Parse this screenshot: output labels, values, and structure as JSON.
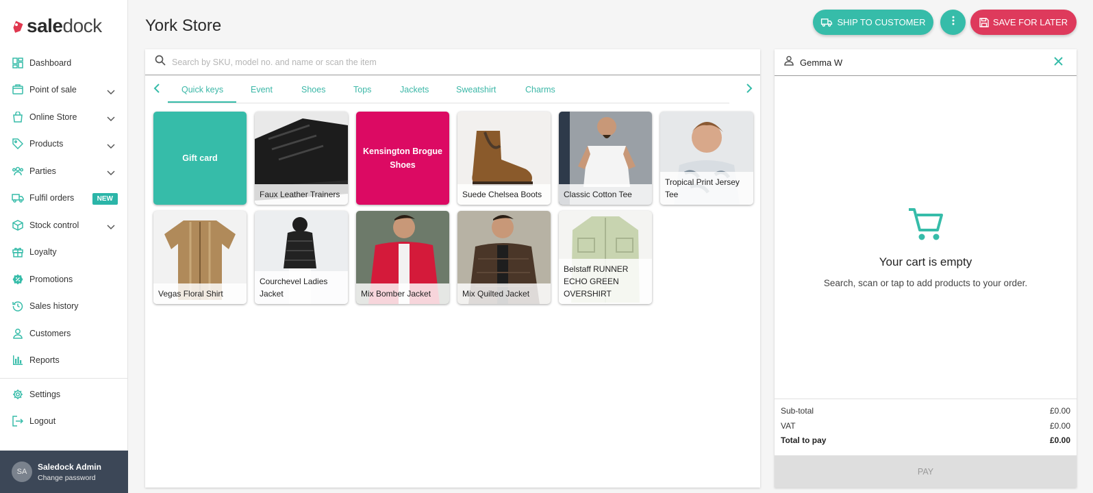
{
  "brand": {
    "logo_text_bold": "sale",
    "logo_text_rest": "dock"
  },
  "sidebar": {
    "items": [
      {
        "label": "Dashboard",
        "icon": "dashboard-icon",
        "has_chevron": false
      },
      {
        "label": "Point of sale",
        "icon": "register-icon",
        "has_chevron": true
      },
      {
        "label": "Online Store",
        "icon": "shopping-bag-icon",
        "has_chevron": true
      },
      {
        "label": "Products",
        "icon": "tag-icon",
        "has_chevron": true
      },
      {
        "label": "Parties",
        "icon": "people-icon",
        "has_chevron": true
      },
      {
        "label": "Fulfil orders",
        "icon": "truck-icon",
        "badge": "NEW"
      },
      {
        "label": "Stock control",
        "icon": "box-icon",
        "has_chevron": true
      },
      {
        "label": "Loyalty",
        "icon": "gift-icon",
        "has_chevron": false
      },
      {
        "label": "Promotions",
        "icon": "percent-badge-icon",
        "has_chevron": false
      },
      {
        "label": "Sales history",
        "icon": "history-icon",
        "has_chevron": false
      },
      {
        "label": "Customers",
        "icon": "person-icon",
        "has_chevron": false
      },
      {
        "label": "Reports",
        "icon": "bar-chart-icon",
        "has_chevron": false
      }
    ],
    "bottom_items": [
      {
        "label": "Settings",
        "icon": "gear-icon"
      },
      {
        "label": "Logout",
        "icon": "logout-icon"
      }
    ],
    "user": {
      "initials": "SA",
      "name": "Saledock Admin",
      "action": "Change password"
    }
  },
  "header": {
    "title": "York Store",
    "ship_label": "SHIP TO CUSTOMER",
    "save_label": "SAVE FOR LATER"
  },
  "search": {
    "placeholder": "Search by SKU, model no. and name or scan the item"
  },
  "tabs": [
    "Quick keys",
    "Event",
    "Shoes",
    "Tops",
    "Jackets",
    "Sweatshirt",
    "Charms"
  ],
  "active_tab": "Quick keys",
  "quick_keys": [
    {
      "label": "Gift card",
      "kind": "solid",
      "color": "#36bca9"
    },
    {
      "label": "Faux Leather Trainers",
      "kind": "image",
      "image": "black trainer shoe"
    },
    {
      "label": "Kensington Brogue Shoes",
      "kind": "solid",
      "color": "#dc0a63"
    },
    {
      "label": "Suede Chelsea Boots",
      "kind": "image",
      "image": "brown chelsea boot"
    },
    {
      "label": "Classic Cotton Tee",
      "kind": "image",
      "image": "man in white tee"
    },
    {
      "label": "Tropical Print Jersey Tee",
      "kind": "image",
      "image": "man in print tee"
    },
    {
      "label": "Vegas Floral Shirt",
      "kind": "image",
      "image": "tan striped shirt"
    },
    {
      "label": "Courchevel Ladies Jacket",
      "kind": "image",
      "image": "black puffer jacket"
    },
    {
      "label": "Mix Bomber Jacket",
      "kind": "image",
      "image": "red bomber jacket"
    },
    {
      "label": "Mix Quilted Jacket",
      "kind": "image",
      "image": "brown quilted jacket"
    },
    {
      "label": "Belstaff RUNNER ECHO GREEN OVERSHIRT",
      "kind": "image",
      "image": "green overshirt"
    }
  ],
  "cart": {
    "customer": "Gemma W",
    "empty_title": "Your cart is empty",
    "empty_subtitle": "Search, scan or tap to add products to your order.",
    "subtotal_label": "Sub-total",
    "subtotal_value": "£0.00",
    "vat_label": "VAT",
    "vat_value": "£0.00",
    "total_label": "Total to pay",
    "total_value": "£0.00",
    "pay_label": "PAY"
  },
  "colors": {
    "accent": "#36bca9",
    "danger": "#de3a5c",
    "sidebar_footer": "#3c4757"
  }
}
